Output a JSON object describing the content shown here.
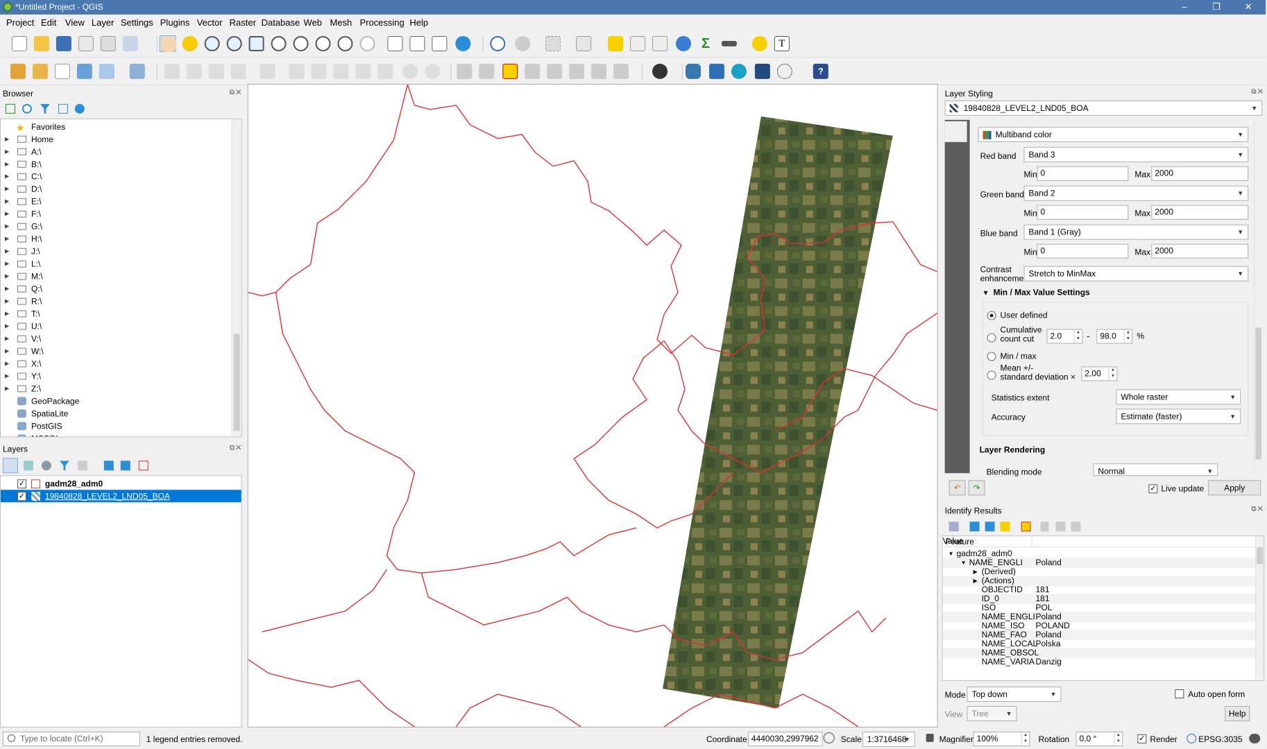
{
  "window": {
    "title": "*Untitled Project - QGIS",
    "minimize": "–",
    "maximize": "❐",
    "close": "✕"
  },
  "menu": [
    "Project",
    "Edit",
    "View",
    "Layer",
    "Settings",
    "Plugins",
    "Vector",
    "Raster",
    "Database",
    "Web",
    "Mesh",
    "Processing",
    "Help"
  ],
  "browser": {
    "title": "Browser",
    "items": [
      "Favorites",
      "Home",
      "A:\\",
      "B:\\",
      "C:\\",
      "D:\\",
      "E:\\",
      "F:\\",
      "G:\\",
      "H:\\",
      "J:\\",
      "L:\\",
      "M:\\",
      "Q:\\",
      "R:\\",
      "T:\\",
      "U:\\",
      "V:\\",
      "W:\\",
      "X:\\",
      "Y:\\",
      "Z:\\",
      "GeoPackage",
      "SpatiaLite",
      "PostGIS",
      "MSSQL"
    ]
  },
  "layers": {
    "title": "Layers",
    "items": [
      {
        "name": "gadm28_adm0",
        "checked": true,
        "selected": false
      },
      {
        "name": "19840828_LEVEL2_LND05_BOA",
        "checked": true,
        "selected": true
      }
    ]
  },
  "styling": {
    "title": "Layer Styling",
    "layer": "19840828_LEVEL2_LND05_BOA",
    "renderer": "Multiband color",
    "red_label": "Red band",
    "red_band": "Band 3",
    "red_min": "0",
    "red_max": "2000",
    "green_label": "Green band",
    "green_band": "Band 2",
    "green_min": "0",
    "green_max": "2000",
    "blue_label": "Blue band",
    "blue_band": "Band 1 (Gray)",
    "blue_min": "0",
    "blue_max": "2000",
    "min_label": "Min",
    "max_label": "Max",
    "contrast_label1": "Contrast",
    "contrast_label2": "enhancement",
    "contrast": "Stretch to MinMax",
    "minmax_header": "Min / Max Value Settings",
    "user_defined": "User defined",
    "cumulative1": "Cumulative",
    "cumulative2": "count cut",
    "cum_low": "2.0",
    "cum_dash": "-",
    "cum_high": "98.0",
    "percent": "%",
    "minmax": "Min / max",
    "meanstd1": "Mean +/-",
    "meanstd2": "standard deviation ×",
    "std": "2.00",
    "stats_extent_label": "Statistics extent",
    "stats_extent": "Whole raster",
    "accuracy_label": "Accuracy",
    "accuracy": "Estimate (faster)",
    "rendering_header": "Layer Rendering",
    "blending_label": "Blending mode",
    "blending": "Normal",
    "live_update": "Live update",
    "apply": "Apply"
  },
  "identify": {
    "title": "Identify Results",
    "col_feature": "Feature",
    "col_value": "Value",
    "rows": [
      {
        "f": "gadm28_adm0",
        "v": "",
        "indent": 1,
        "arrow": "▼"
      },
      {
        "f": "NAME_ENGLI",
        "v": "Poland",
        "indent": 2,
        "arrow": "▼"
      },
      {
        "f": "(Derived)",
        "v": "",
        "indent": 3,
        "arrow": "▶"
      },
      {
        "f": "(Actions)",
        "v": "",
        "indent": 3,
        "arrow": "▶"
      },
      {
        "f": "OBJECTID",
        "v": "181",
        "indent": 3,
        "arrow": ""
      },
      {
        "f": "ID_0",
        "v": "181",
        "indent": 3,
        "arrow": ""
      },
      {
        "f": "ISO",
        "v": "POL",
        "indent": 3,
        "arrow": ""
      },
      {
        "f": "NAME_ENGLI",
        "v": "Poland",
        "indent": 3,
        "arrow": ""
      },
      {
        "f": "NAME_ISO",
        "v": "POLAND",
        "indent": 3,
        "arrow": ""
      },
      {
        "f": "NAME_FAO",
        "v": "Poland",
        "indent": 3,
        "arrow": ""
      },
      {
        "f": "NAME_LOCAL",
        "v": "Polska",
        "indent": 3,
        "arrow": ""
      },
      {
        "f": "NAME_OBSOL",
        "v": "",
        "indent": 3,
        "arrow": ""
      },
      {
        "f": "NAME_VARIA",
        "v": "Danzig",
        "indent": 3,
        "arrow": ""
      }
    ],
    "mode_label": "Mode",
    "mode": "Top down",
    "auto_open": "Auto open form",
    "view_label": "View",
    "view": "Tree",
    "help": "Help"
  },
  "status": {
    "locate_placeholder": "Type to locate (Ctrl+K)",
    "message": "1 legend entries removed.",
    "coord_label": "Coordinate",
    "coord": "4440030,2997962",
    "scale_label": "Scale",
    "scale": "1:3716468",
    "magnifier_label": "Magnifier",
    "magnifier": "100%",
    "rotation_label": "Rotation",
    "rotation": "0.0 °",
    "render_label": "Render",
    "crs": "EPSG:3035"
  },
  "colors": {
    "accent": "#4b78b0",
    "selection": "#0078d7",
    "border": "#e03030"
  }
}
